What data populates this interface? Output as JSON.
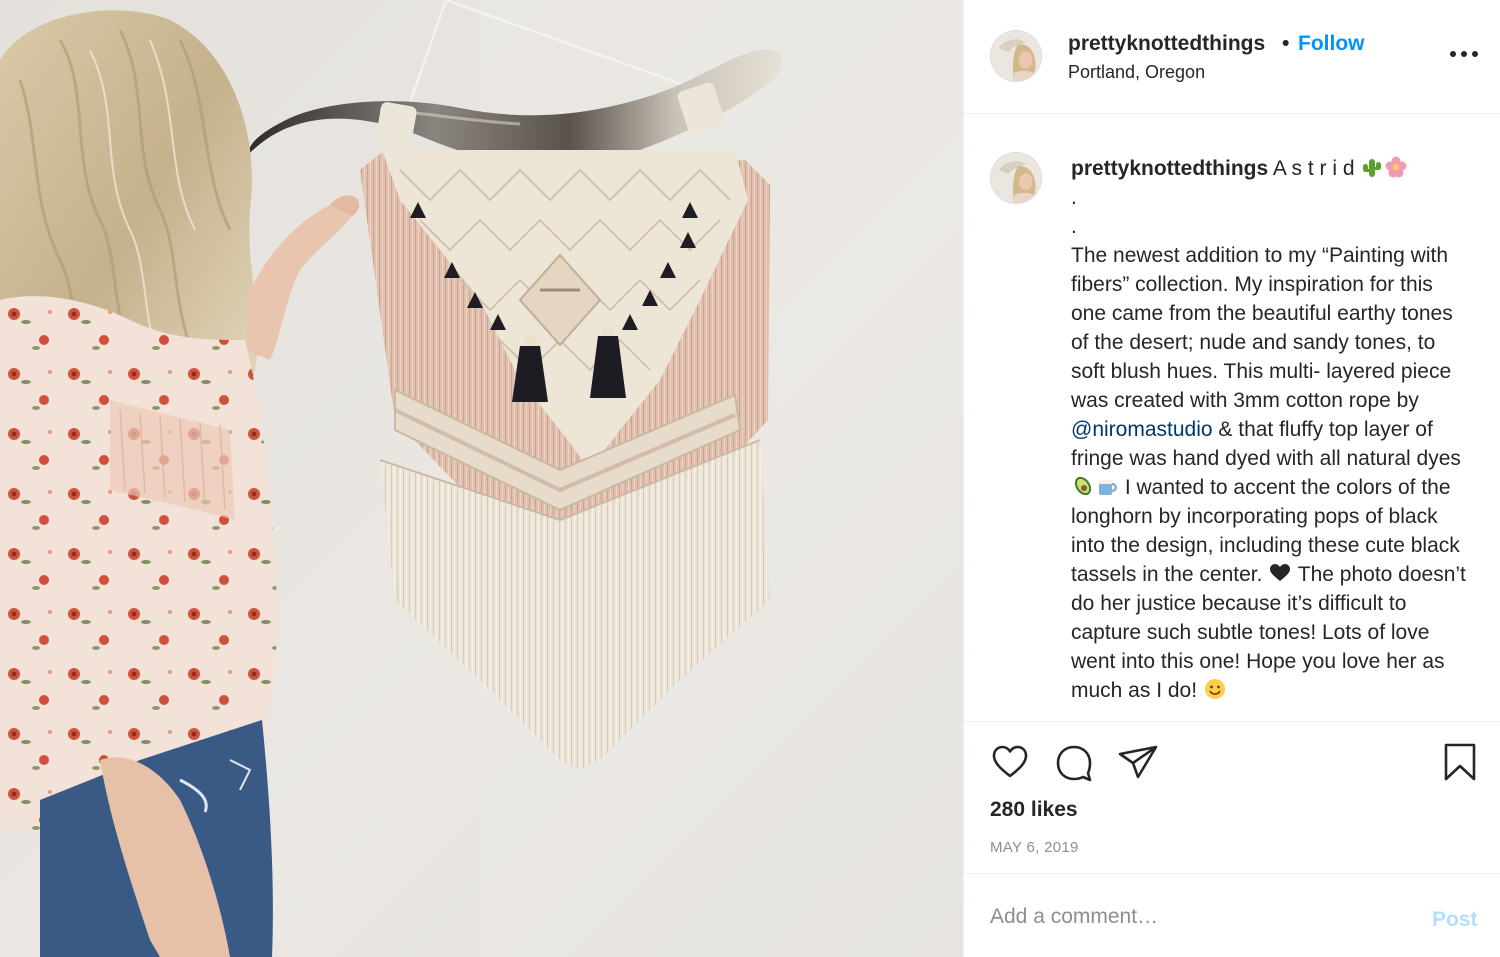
{
  "photo": {
    "icon": "post-photo-macrame-longhorn"
  },
  "header": {
    "username": "prettyknottedthings",
    "separator": "•",
    "follow_label": "Follow",
    "location": "Portland, Oregon",
    "more_icon": "more-options-icon"
  },
  "caption": {
    "username": "prettyknottedthings",
    "title": "A s t r i d",
    "dot1": ".",
    "dot2": ".",
    "text1": "The newest addition to my “Painting with fibers” collection. My inspiration for this one came from the beautiful earthy tones of the desert; nude and sandy tones, to soft blush hues. This multi- layered piece was created with 3mm cotton rope by",
    "mention": "@niromastudio",
    "text2": "& that fluffy top layer of fringe was hand dyed with all natural dyes",
    "text3": "I wanted to accent the colors of the longhorn by incorporating pops of black into the design, including these cute black tassels in the center.",
    "text4": "The photo doesn’t do her justice because it’s difficult to capture such subtle tones! Lots of love went into this one! Hope you love her as much as I do!",
    "emojis": [
      "cactus-emoji",
      "blossom-emoji",
      "avocado-emoji",
      "mug-emoji",
      "black-heart-emoji",
      "smile-emoji"
    ]
  },
  "actions": {
    "like_icon": "heart-icon",
    "comment_icon": "comment-icon",
    "share_icon": "paper-plane-icon",
    "save_icon": "bookmark-icon"
  },
  "likes": "280 likes",
  "date": "MAY 6, 2019",
  "comment": {
    "placeholder": "Add a comment…",
    "value": "",
    "post_label": "Post"
  },
  "colors": {
    "accent": "#0095f6",
    "post_disabled": "#b2dffc",
    "text": "#262626",
    "muted": "#8e8e8e",
    "mention": "#00376b",
    "border": "#efefef"
  }
}
